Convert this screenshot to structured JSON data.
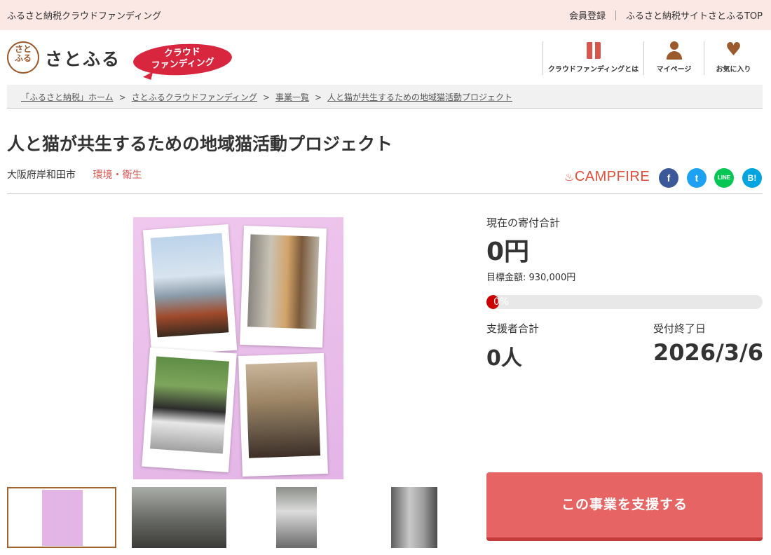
{
  "topbar": {
    "site_name": "ふるさと納税クラウドファンディング",
    "register": "会員登録",
    "satofull_top": "ふるさと納税サイトさとふるTOP"
  },
  "header": {
    "logo_mark": "さとふる",
    "logo_text": "さとふる",
    "cf_badge_line1": "クラウド",
    "cf_badge_line2": "ファンディング",
    "nav": [
      {
        "label": "クラウドファンディングとは",
        "icon": "book-icon"
      },
      {
        "label": "マイページ",
        "icon": "user-icon"
      },
      {
        "label": "お気に入り",
        "icon": "heart-icon"
      }
    ]
  },
  "breadcrumb": [
    "「ふるさと納税」ホーム",
    "さとふるクラウドファンディング",
    "事業一覧",
    "人と猫が共生するための地域猫活動プロジェクト"
  ],
  "project": {
    "title": "人と猫が共生するための地域猫活動プロジェクト",
    "city": "大阪府岸和田市",
    "category": "環境・衛生",
    "platform": "CAMPFIRE",
    "platform_flame": "♨"
  },
  "social": {
    "facebook": "f",
    "twitter": "t",
    "line": "LINE",
    "hatena": "B!"
  },
  "stats": {
    "total_label": "現在の寄付合計",
    "total_value": "0円",
    "target": "目標金額: 930,000円",
    "progress_text": "0%",
    "progress_fraction": 0.0,
    "supporters_label": "支援者合計",
    "supporters_value": "0人",
    "deadline_label": "受付終了日",
    "deadline_value": "2026/3/6"
  },
  "support_button": "この事業を支援する"
}
